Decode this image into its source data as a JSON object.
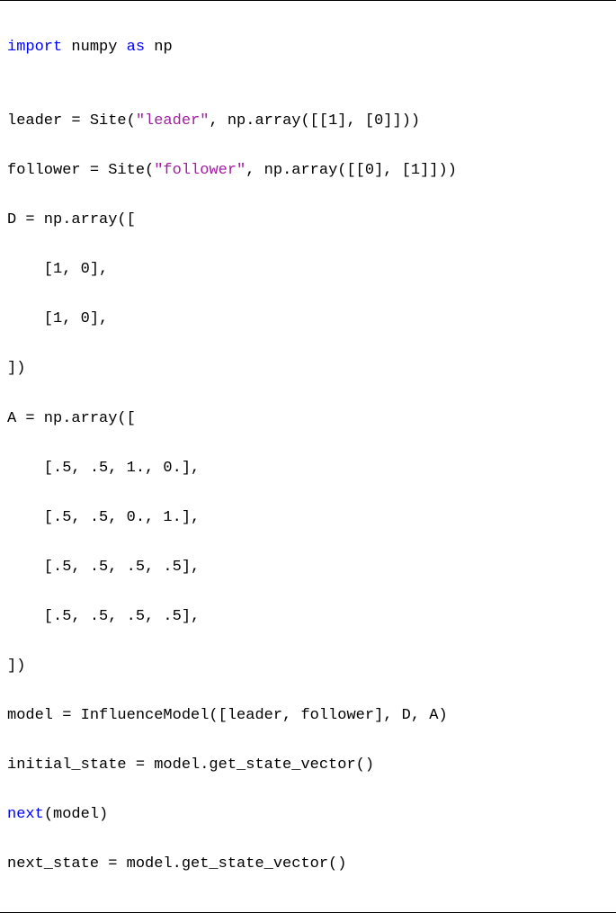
{
  "tokens": {
    "kw_import": "import",
    "kw_next": "next",
    "str_leader": "\"leader\"",
    "str_follower": "\"follower\""
  },
  "lines": {
    "l1a": " numpy ",
    "l1b": "as",
    "l1c": " np",
    "blank": "",
    "l3a": "leader = Site(",
    "l3b": ", np.array([[1], [0]]))",
    "l4a": "follower = Site(",
    "l4b": ", np.array([[0], [1]]))",
    "l5": "D = np.array([",
    "l6": "    [1, 0],",
    "l7": "    [1, 0],",
    "l8": "])",
    "l9": "A = np.array([",
    "l10": "    [.5, .5, 1., 0.],",
    "l11": "    [.5, .5, 0., 1.],",
    "l12": "    [.5, .5, .5, .5],",
    "l13": "    [.5, .5, .5, .5],",
    "l14": "])",
    "l15": "model = InfluenceModel([leader, follower], D, A)",
    "l16": "initial_state = model.get_state_vector()",
    "l17b": "(model)",
    "l18": "next_state = model.get_state_vector()"
  }
}
